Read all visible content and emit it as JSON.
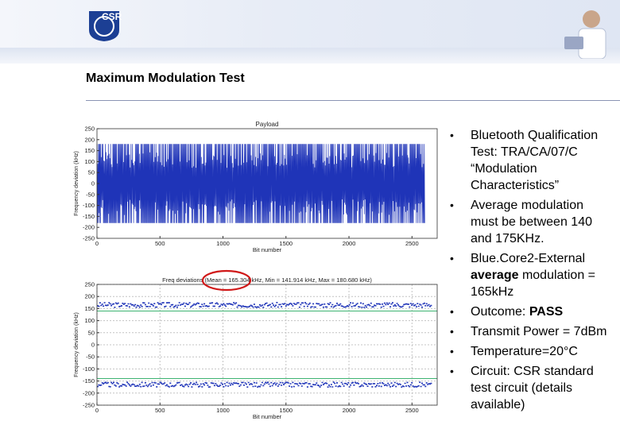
{
  "header": {
    "logo_text": "CSR"
  },
  "slide": {
    "title": "Maximum Modulation Test"
  },
  "chart_data": [
    {
      "type": "line",
      "title": "Payload",
      "xlabel": "Bit number",
      "ylabel": "Frequency deviation (kHz)",
      "xlim": [
        0,
        2700
      ],
      "ylim": [
        -250,
        250
      ],
      "xticks": [
        0,
        500,
        1000,
        1500,
        2000,
        2500
      ],
      "yticks": [
        250,
        200,
        150,
        100,
        50,
        0,
        -50,
        -100,
        -150,
        -200,
        -250
      ],
      "grid": false,
      "series": [
        {
          "color": "#1f34b8",
          "pattern": "alternating",
          "min": -180,
          "max": 180
        }
      ]
    },
    {
      "type": "scatter",
      "title": "Freq deviations  (Mean = 165.304 kHz,  Min = 141.914 kHz,  Max = 180.680 kHz)",
      "xlabel": "Bit number",
      "ylabel": "Frequency deviation (kHz)",
      "xlim": [
        0,
        2700
      ],
      "ylim": [
        -250,
        250
      ],
      "xticks": [
        0,
        500,
        1000,
        1500,
        2000,
        2500
      ],
      "yticks": [
        250,
        200,
        150,
        100,
        50,
        0,
        -50,
        -100,
        -150,
        -200,
        -250
      ],
      "grid": true,
      "reference_lines": [
        140,
        -140
      ],
      "series": [
        {
          "color": "#1f34b8",
          "band_center": 165,
          "band_spread": 10
        },
        {
          "color": "#1f34b8",
          "band_center": -165,
          "band_spread": 10
        }
      ],
      "highlight": "Mean = 165.304 kHz"
    }
  ],
  "bullets": [
    {
      "lines": [
        "Bluetooth Qualification",
        "Test: TRA/CA/07/C",
        "“Modulation",
        "Characteristics”"
      ]
    },
    {
      "lines": [
        "Average modulation",
        "must be between 140",
        "and 175KHz."
      ]
    },
    {
      "lines": [
        "Blue.Core2-External"
      ],
      "bold": "average",
      "rest": " modulation =",
      "tail": "165kHz"
    },
    {
      "prefix": "Outcome: ",
      "bold": "PASS"
    },
    {
      "lines": [
        "Transmit Power = 7dBm"
      ]
    },
    {
      "lines": [
        "Temperature=20°C"
      ]
    },
    {
      "lines": [
        "Circuit: CSR standard",
        "test circuit (details",
        "available)"
      ]
    }
  ],
  "colors": {
    "trace": "#1f34b8",
    "limit": "#3cb371",
    "highlight": "#d01818"
  }
}
